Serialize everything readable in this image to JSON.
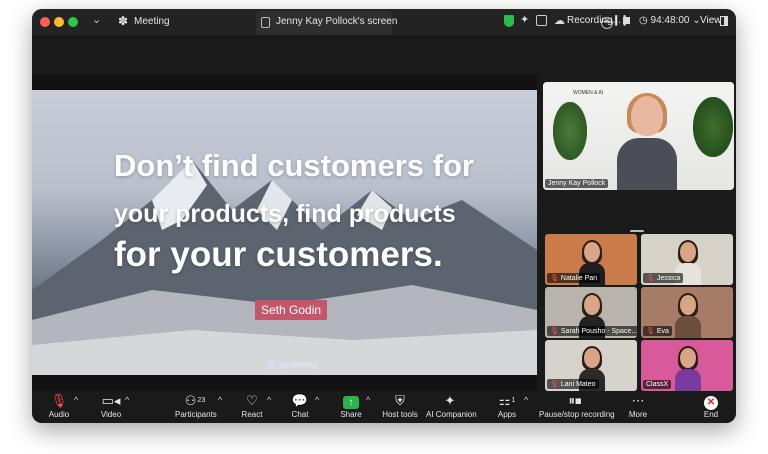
{
  "titlebar": {
    "meeting_label": "Meeting",
    "screen_tab_label": "Jenny Kay Pollock's screen",
    "recording_label": "Recording...",
    "timer": "94:48:00",
    "view_label": "View"
  },
  "shared_screen": {
    "quote_line1": "Don’t find customers for",
    "quote_line2": "your products, find products",
    "quote_line3": "for your customers.",
    "author": "Seth Godin",
    "watermark": "quotefancy"
  },
  "main_video": {
    "name": "Jenny Kay Pollock",
    "sign_text": "WOMEN & AI"
  },
  "gallery": [
    {
      "name": "Natalie Pan",
      "muted": true,
      "bg": "#c97b4a",
      "shirt": "#1f1f1f"
    },
    {
      "name": "Jessica",
      "muted": true,
      "bg": "#d7d2c8",
      "shirt": "#e6e3dd"
    },
    {
      "name": "Sarah Pousho - Space...",
      "muted": true,
      "bg": "#b8b3ab",
      "shirt": "#222222"
    },
    {
      "name": "Eva",
      "muted": true,
      "bg": "#a67c66",
      "shirt": "#6c4e3e"
    },
    {
      "name": "Lani Mateo",
      "muted": true,
      "bg": "#d6d3cc",
      "shirt": "#2a2a2a"
    },
    {
      "name": "ClassX",
      "muted": false,
      "bg": "#d95a9a",
      "shirt": "#7a3aa0"
    }
  ],
  "toolbar": {
    "audio": "Audio",
    "video": "Video",
    "participants": "Participants",
    "participants_count": "23",
    "react": "React",
    "chat": "Chat",
    "share": "Share",
    "host_tools": "Host tools",
    "ai_companion": "AI Companion",
    "apps": "Apps",
    "apps_count": "1",
    "recording": "Pause/stop recording",
    "more": "More",
    "end": "End"
  },
  "colors": {
    "share_green": "#2bb44a",
    "shield_green": "#2dbd4e",
    "end_red": "#e02424",
    "author_badge": "#c3566b"
  },
  "icons": {
    "audio": "mic-muted-icon",
    "video": "camera-icon",
    "participants": "people-icon",
    "react": "heart-icon",
    "chat": "speech-bubble-icon",
    "share": "share-arrow-icon",
    "host_tools": "shield-icon",
    "ai_companion": "sparkle-icon",
    "apps": "apps-grid-icon",
    "recording": "pause-stop-icon",
    "more": "ellipsis-icon",
    "end": "close-icon"
  }
}
